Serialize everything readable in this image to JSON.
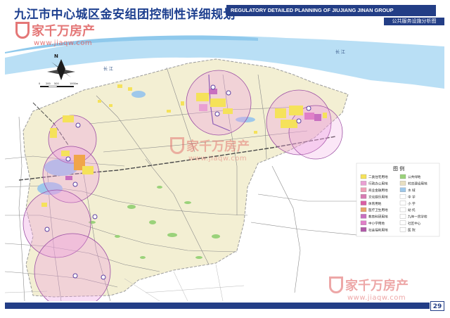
{
  "header": {
    "title_cn": "九江市中心城区金安组团控制性详细规划",
    "title_en": "REGULATORY DETAILED PLANNING OF JIUJIANG JINAN GROUP",
    "subtitle": "公共服务设施分析图"
  },
  "map": {
    "north_label": "N",
    "scale_labels": [
      "0",
      "200",
      "500",
      "1000m"
    ],
    "river_label": "长 江",
    "legend": {
      "title": "图 例",
      "items": [
        {
          "label": "二类住宅用地",
          "color": "#f5e25a"
        },
        {
          "label": "行政办公用地",
          "color": "#e9a0d3"
        },
        {
          "label": "商业金融用地",
          "color": "#ef9fb6"
        },
        {
          "label": "文化娱乐用地",
          "color": "#d77bb3"
        },
        {
          "label": "体育用地",
          "color": "#d95ea3"
        },
        {
          "label": "医疗卫生用地",
          "color": "#e8a468"
        },
        {
          "label": "教育科研用地",
          "color": "#c86fc0"
        },
        {
          "label": "中小学用地",
          "color": "#e080c8"
        },
        {
          "label": "社会福利用地",
          "color": "#b05aa8"
        },
        {
          "label": "公共绿地",
          "color": "#9ad27a"
        },
        {
          "label": "村庄建设用地",
          "color": "#e8dfc0"
        },
        {
          "label": "水 域",
          "color": "#9ec8eb"
        },
        {
          "label": "中 学",
          "color": "#ffffff"
        },
        {
          "label": "小 学",
          "color": "#ffffff"
        },
        {
          "label": "幼 托",
          "color": "#ffffff"
        },
        {
          "label": "九年一贯学校",
          "color": "#ffffff"
        },
        {
          "label": "社区中心",
          "color": "#ffffff"
        },
        {
          "label": "医 院",
          "color": "#ffffff"
        }
      ]
    }
  },
  "watermark": {
    "name": "家千万房产",
    "url": "www.jiaqw.com"
  },
  "page_number": "29"
}
